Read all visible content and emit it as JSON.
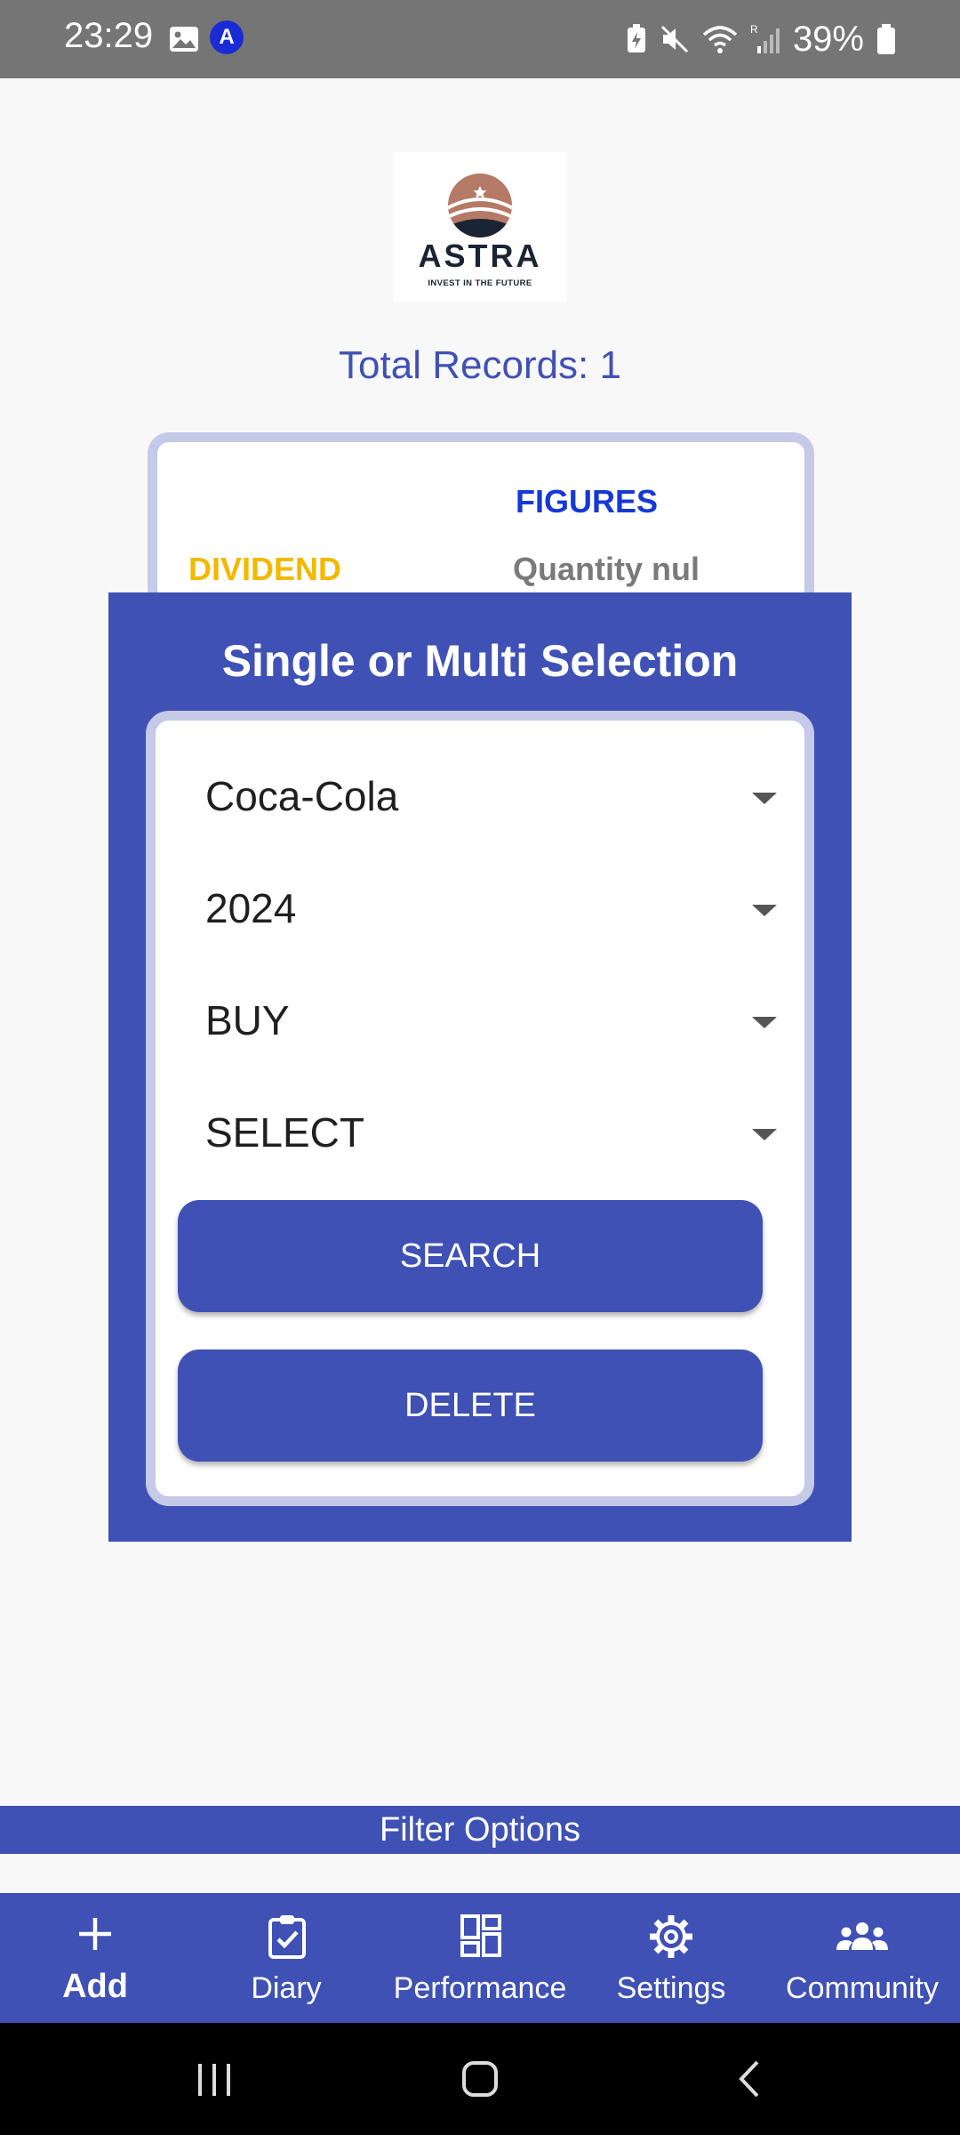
{
  "status_bar": {
    "time": "23:29",
    "app_badge": "A",
    "battery": "39%"
  },
  "logo": {
    "brand": "ASTRA",
    "tagline": "INVEST IN THE FUTURE"
  },
  "records": {
    "label": "Total Records: 1"
  },
  "card": {
    "figures_header": "FIGURES",
    "type_label": "DIVIDEND",
    "quantity_text": "Quantity nul"
  },
  "dialog": {
    "title": "Single or Multi Selection",
    "dropdowns": [
      {
        "value": "Coca-Cola"
      },
      {
        "value": "2024"
      },
      {
        "value": "BUY"
      },
      {
        "value": "SELECT"
      }
    ],
    "search_label": "SEARCH",
    "delete_label": "DELETE"
  },
  "filter_bar": {
    "label": "Filter Options"
  },
  "bottom_nav": {
    "items": [
      {
        "label": "Add",
        "icon": "plus-icon"
      },
      {
        "label": "Diary",
        "icon": "clipboard-check-icon"
      },
      {
        "label": "Performance",
        "icon": "dashboard-icon"
      },
      {
        "label": "Settings",
        "icon": "gear-icon"
      },
      {
        "label": "Community",
        "icon": "people-icon"
      }
    ]
  },
  "colors": {
    "primary": "#3f51b5",
    "accent_light": "#c5cae9",
    "figures_blue": "#1538d6",
    "dividend_yellow": "#f5b800"
  }
}
